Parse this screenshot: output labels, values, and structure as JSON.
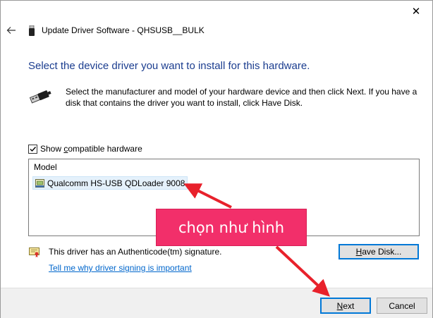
{
  "window": {
    "title": "Update Driver Software - QHSUSB__BULK",
    "close_glyph": "✕"
  },
  "main": {
    "heading": "Select the device driver you want to install for this hardware.",
    "description": "Select the manufacturer and model of your hardware device and then click Next. If you have a disk that contains the driver you want to install, click Have Disk."
  },
  "compat": {
    "checked": true,
    "label_prefix": "Show ",
    "label_underlined": "c",
    "label_suffix": "ompatible hardware"
  },
  "model_list": {
    "header": "Model",
    "items": [
      {
        "label": "Qualcomm HS-USB QDLoader 9008",
        "selected": true
      }
    ]
  },
  "signature": {
    "text": "This driver has an Authenticode(tm) signature.",
    "link": "Tell me why driver signing is important"
  },
  "buttons": {
    "have_disk_underlined": "H",
    "have_disk_rest": "ave Disk...",
    "next_underlined": "N",
    "next_rest": "ext",
    "cancel": "Cancel"
  },
  "annotation": {
    "text": "chọn như hình",
    "color": "#f22f6a"
  },
  "colors": {
    "heading": "#1b3d8f",
    "link": "#0066cc",
    "focus": "#0078d7",
    "arrow": "#e8212b"
  },
  "icons": {
    "back": "back-arrow-icon",
    "device": "usb-device-icon",
    "usb": "usb-cable-icon",
    "driver": "driver-icon",
    "signature": "certificate-icon"
  }
}
